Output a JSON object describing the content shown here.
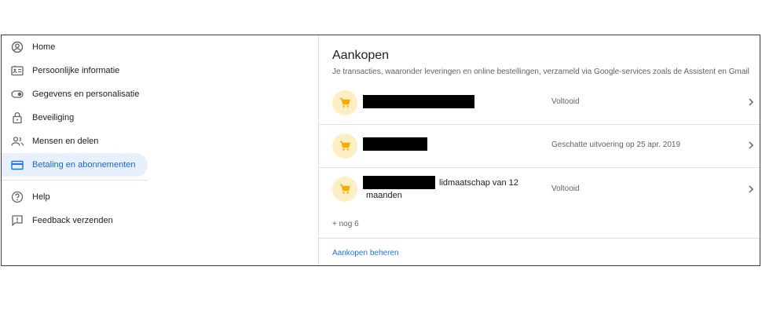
{
  "sidebar": {
    "items": [
      {
        "label": "Home",
        "icon": "account-circle-icon"
      },
      {
        "label": "Persoonlijke informatie",
        "icon": "id-card-icon"
      },
      {
        "label": "Gegevens en personalisatie",
        "icon": "toggle-icon"
      },
      {
        "label": "Beveiliging",
        "icon": "lock-icon"
      },
      {
        "label": "Mensen en delen",
        "icon": "people-icon"
      },
      {
        "label": "Betaling en abonnementen",
        "icon": "credit-card-icon"
      },
      {
        "label": "Help",
        "icon": "help-icon"
      },
      {
        "label": "Feedback verzenden",
        "icon": "feedback-icon"
      }
    ],
    "active_index": 5
  },
  "purchases": {
    "title": "Aankopen",
    "subtitle": "Je transacties, waaronder leveringen en online bestellingen, verzameld via Google-services zoals de Assistent en Gmail",
    "rows": [
      {
        "name": "",
        "status": "Voltooid"
      },
      {
        "name": "",
        "status": "Geschatte uitvoering op 25 apr. 2019"
      },
      {
        "name": "lidmaatschap van 12",
        "name_line2": "maanden",
        "status": "Voltooid"
      }
    ],
    "more": "+ nog 6",
    "manage_link": "Aankopen beheren"
  },
  "colors": {
    "accent": "#1a73e8",
    "active_bg": "#e8f0fe",
    "cart_bg": "#fdefc4",
    "cart_icon": "#f9ab00"
  }
}
